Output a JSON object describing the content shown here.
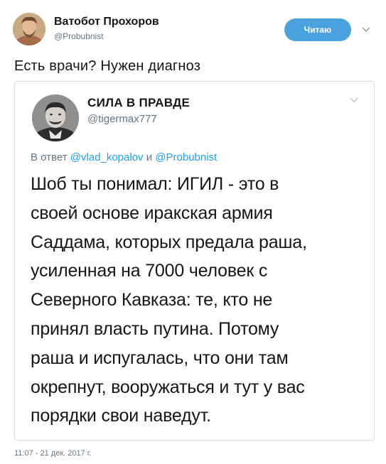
{
  "author": {
    "display_name": "Ватобот Прохоров",
    "handle": "@Probubnist",
    "follow_button_label": "Читаю"
  },
  "tweet": {
    "text": "Есть врачи? Нужен диагноз",
    "timestamp": "11:07 - 21 дек. 2017 г."
  },
  "quoted_tweet": {
    "display_name": "СИЛА В ПРАВДЕ",
    "handle": "@tigermax777",
    "reply_prefix": "В ответ",
    "reply_mention_1": "@vlad_kopalov",
    "reply_conjunction": "и",
    "reply_mention_2": "@Probubnist",
    "body": "Шоб ты понимал: ИГИЛ - это в\nсвоей основе иракская армия\nСаддама, которых предала раша,\nусиленная на 7000 человек с\nСеверного Кавказа: те, кто не\nпринял власть путина. Потому\nраша и испугалась, что они там\nокрепнут, вооружаться и тут у вас\nпорядки свои наведут."
  },
  "icons": {
    "top_menu": "chevron-down-icon",
    "quote_menu": "chevron-down-icon"
  },
  "colors": {
    "follow_button": "#4aa3df",
    "mention": "#1da1f2",
    "secondary_text": "#657786",
    "card_border": "#d9dde1"
  }
}
